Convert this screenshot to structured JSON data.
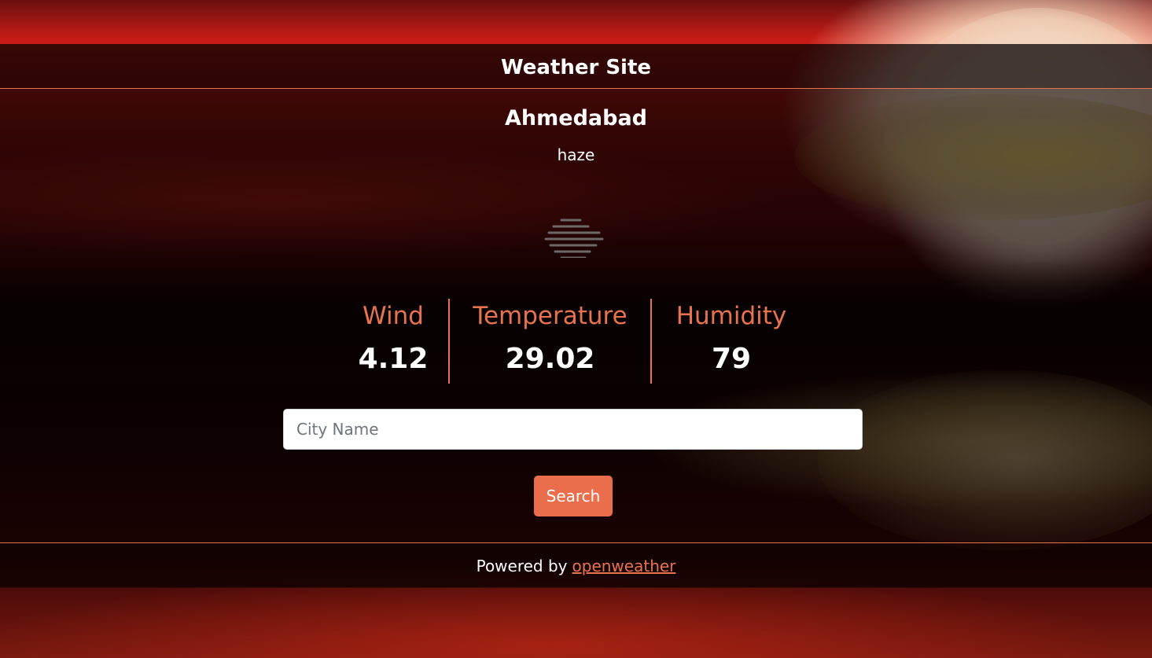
{
  "header": {
    "title": "Weather Site"
  },
  "location": {
    "city": "Ahmedabad",
    "condition": "haze",
    "icon": "haze-icon"
  },
  "stats": {
    "wind": {
      "label": "Wind",
      "value": "4.12"
    },
    "temperature": {
      "label": "Temperature",
      "value": "29.02"
    },
    "humidity": {
      "label": "Humidity",
      "value": "79"
    }
  },
  "search": {
    "placeholder": "City Name",
    "value": "",
    "button_label": "Search"
  },
  "footer": {
    "prefix": "Powered by",
    "link_text": "openweather"
  },
  "colors": {
    "accent": "#e8734f",
    "button": "#ea6e4b",
    "text": "#ffffff"
  }
}
